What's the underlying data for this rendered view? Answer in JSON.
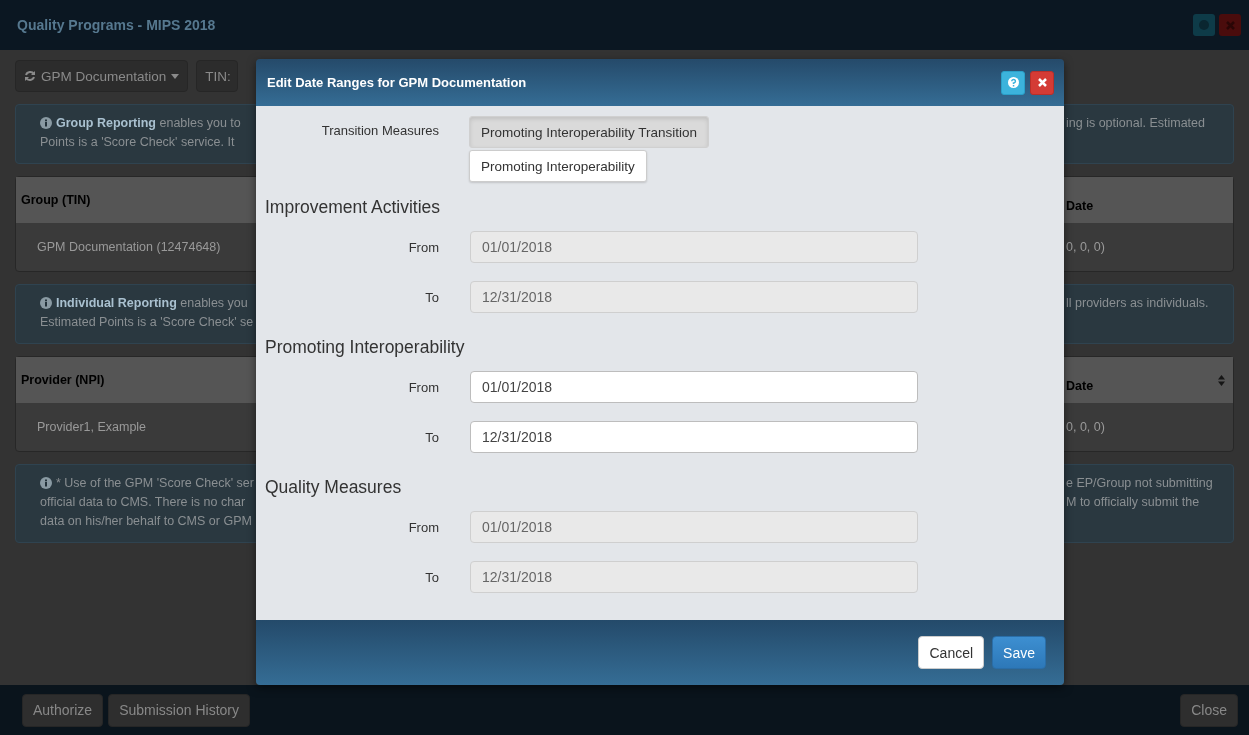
{
  "window": {
    "title": "Quality Programs - MIPS 2018"
  },
  "toolbar": {
    "group_dropdown": "GPM Documentation",
    "tin_label": "TIN:"
  },
  "sections": [
    {
      "kind": "note",
      "left_lines": [
        "**Group Reporting** enables you to",
        "Points is a 'Score Check' service. It"
      ],
      "right_lines": [
        "ing is optional. Estimated"
      ]
    },
    {
      "kind": "table",
      "header_left": "Group (TIN)",
      "header_right": "Date",
      "sortable": false,
      "cell_left": "GPM Documentation (12474648)",
      "cell_right": "0, 0, 0)"
    },
    {
      "kind": "note",
      "left_lines": [
        "**Individual Reporting** enables you",
        "Estimated Points is a 'Score Check' se"
      ],
      "right_lines": [
        "ll providers as individuals."
      ]
    },
    {
      "kind": "table",
      "header_left": "Provider (NPI)",
      "header_right": "Date",
      "sortable": true,
      "cell_left": "Provider1, Example",
      "cell_right": "0, 0, 0)"
    },
    {
      "kind": "note",
      "left_lines": [
        "* Use of the GPM 'Score Check' ser",
        "official data to CMS. There is no char",
        "data on his/her behalf to CMS or GPM"
      ],
      "right_lines": [
        "e EP/Group not submitting",
        "M to officially submit the"
      ]
    }
  ],
  "footer": {
    "buttons": [
      "Authorize",
      "Submission History"
    ],
    "close": "Close"
  },
  "dialog": {
    "title": "Edit Date Ranges for GPM Documentation",
    "transition_label": "Transition Measures",
    "transition_options": [
      {
        "label": "Promoting Interoperability Transition",
        "selected": true
      },
      {
        "label": "Promoting Interoperability",
        "selected": false
      }
    ],
    "groups": [
      {
        "heading": "Improvement Activities",
        "disabled": true,
        "fields": [
          {
            "label": "From",
            "value": "01/01/2018"
          },
          {
            "label": "To",
            "value": "12/31/2018"
          }
        ]
      },
      {
        "heading": "Promoting Interoperability",
        "disabled": false,
        "fields": [
          {
            "label": "From",
            "value": "01/01/2018"
          },
          {
            "label": "To",
            "value": "12/31/2018"
          }
        ]
      },
      {
        "heading": "Quality Measures",
        "disabled": true,
        "fields": [
          {
            "label": "From",
            "value": "01/01/2018"
          },
          {
            "label": "To",
            "value": "12/31/2018"
          }
        ]
      }
    ],
    "buttons": [
      {
        "label": "Cancel",
        "kind": "default"
      },
      {
        "label": "Save",
        "kind": "primary"
      }
    ]
  }
}
